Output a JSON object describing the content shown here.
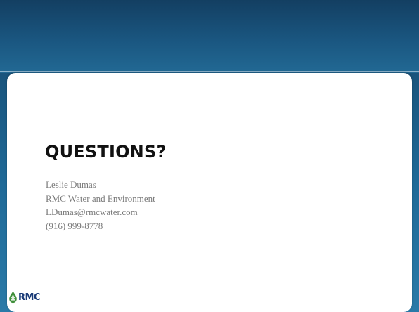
{
  "slide": {
    "title": "QUESTIONS?",
    "contact": {
      "name": "Leslie Dumas",
      "organization": "RMC Water and Environment",
      "email": "LDumas@rmcwater.com",
      "phone": "(916) 999-8778"
    }
  },
  "logo": {
    "text": "RMC",
    "icon": "water-drop-tree-icon"
  },
  "colors": {
    "header_dark": "#133f62",
    "header_light": "#226994",
    "card_background": "#ffffff",
    "title_text": "#111111",
    "body_text": "#7a7a7a",
    "logo_green": "#3f8f3a",
    "logo_blue": "#1b3c78"
  }
}
